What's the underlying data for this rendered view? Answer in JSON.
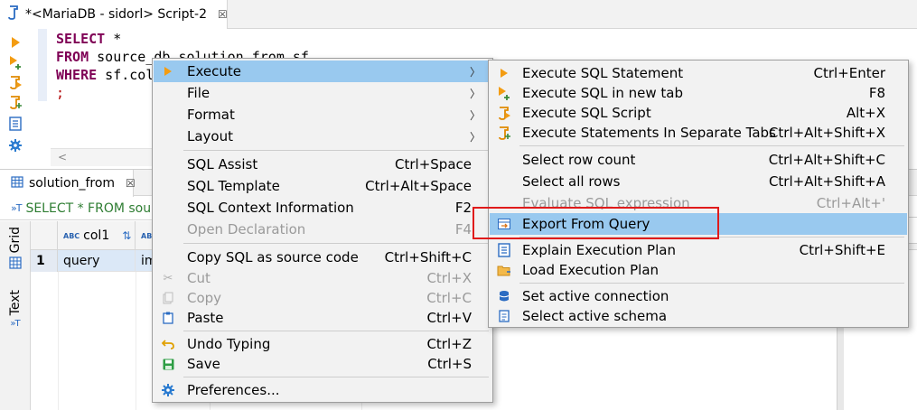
{
  "editor_tab": {
    "title": "*<MariaDB - sidorl> Script-2",
    "close": "☒"
  },
  "editor": {
    "lines": [
      {
        "kw": "SELECT",
        "rest": " *"
      },
      {
        "kw": "FROM",
        "rest": " source_db.solution_from sf"
      },
      {
        "kw": "WHERE",
        "rest": " sf.col"
      },
      {
        "kw": "",
        "rest": ";"
      }
    ],
    "scroll_left": "<"
  },
  "results": {
    "tab_title": "solution_from",
    "tab_close": "☒",
    "query_text": "SELECT * FROM sour",
    "side_tabs": [
      "Grid",
      "Text"
    ],
    "columns": [
      {
        "label": "col1",
        "type": "ABC"
      },
      {
        "label": "",
        "type": "ABC"
      }
    ],
    "rows": [
      {
        "num": "1",
        "cells": [
          "query",
          "im"
        ]
      }
    ]
  },
  "context_menu": {
    "items": [
      {
        "label": "Execute",
        "shortcut": "",
        "submenu": true,
        "icon": "execute-icon",
        "highlighted": true
      },
      {
        "label": "File",
        "shortcut": "",
        "submenu": true
      },
      {
        "label": "Format",
        "shortcut": "",
        "submenu": true
      },
      {
        "label": "Layout",
        "shortcut": "",
        "submenu": true
      },
      {
        "label": "SQL Assist",
        "shortcut": "Ctrl+Space"
      },
      {
        "label": "SQL Template",
        "shortcut": "Ctrl+Alt+Space"
      },
      {
        "label": "SQL Context Information",
        "shortcut": "F2"
      },
      {
        "label": "Open Declaration",
        "shortcut": "F4",
        "disabled": true
      },
      {
        "label": "Copy SQL as source code",
        "shortcut": "Ctrl+Shift+C"
      },
      {
        "label": "Cut",
        "shortcut": "Ctrl+X",
        "disabled": true,
        "icon": "cut-icon"
      },
      {
        "label": "Copy",
        "shortcut": "Ctrl+C",
        "disabled": true,
        "icon": "copy-icon"
      },
      {
        "label": "Paste",
        "shortcut": "Ctrl+V",
        "icon": "paste-icon"
      },
      {
        "label": "Undo Typing",
        "shortcut": "Ctrl+Z",
        "icon": "undo-icon"
      },
      {
        "label": "Save",
        "shortcut": "Ctrl+S",
        "icon": "save-icon"
      },
      {
        "label": "Preferences...",
        "shortcut": "",
        "icon": "gear-icon"
      }
    ]
  },
  "execute_submenu": {
    "items": [
      {
        "label": "Execute SQL Statement",
        "shortcut": "Ctrl+Enter",
        "icon": "execute-statement-icon"
      },
      {
        "label": "Execute SQL in new tab",
        "shortcut": "F8",
        "icon": "execute-new-tab-icon"
      },
      {
        "label": "Execute SQL Script",
        "shortcut": "Alt+X",
        "icon": "execute-script-icon"
      },
      {
        "label": "Execute Statements In Separate Tabs",
        "shortcut": "Ctrl+Alt+Shift+X",
        "icon": "execute-separate-tabs-icon"
      },
      {
        "label": "Select row count",
        "shortcut": "Ctrl+Alt+Shift+C"
      },
      {
        "label": "Select all rows",
        "shortcut": "Ctrl+Alt+Shift+A"
      },
      {
        "label": "Evaluate SQL expression",
        "shortcut": "Ctrl+Alt+'",
        "disabled": true
      },
      {
        "label": "Export From Query",
        "shortcut": "",
        "highlighted": true,
        "icon": "export-icon"
      },
      {
        "label": "Explain Execution Plan",
        "shortcut": "Ctrl+Shift+E",
        "icon": "explain-plan-icon"
      },
      {
        "label": "Load Execution Plan",
        "shortcut": "",
        "icon": "load-plan-icon"
      },
      {
        "label": "Set active connection",
        "shortcut": "",
        "icon": "database-icon"
      },
      {
        "label": "Select active schema",
        "shortcut": "",
        "icon": "schema-icon"
      }
    ]
  },
  "colors": {
    "keyword": "#7f0055",
    "menu_highlight": "#99c9ef",
    "annotation_box": "#e01b1b",
    "execute_orange": "#f39c12",
    "query_green": "#2e7d32"
  }
}
